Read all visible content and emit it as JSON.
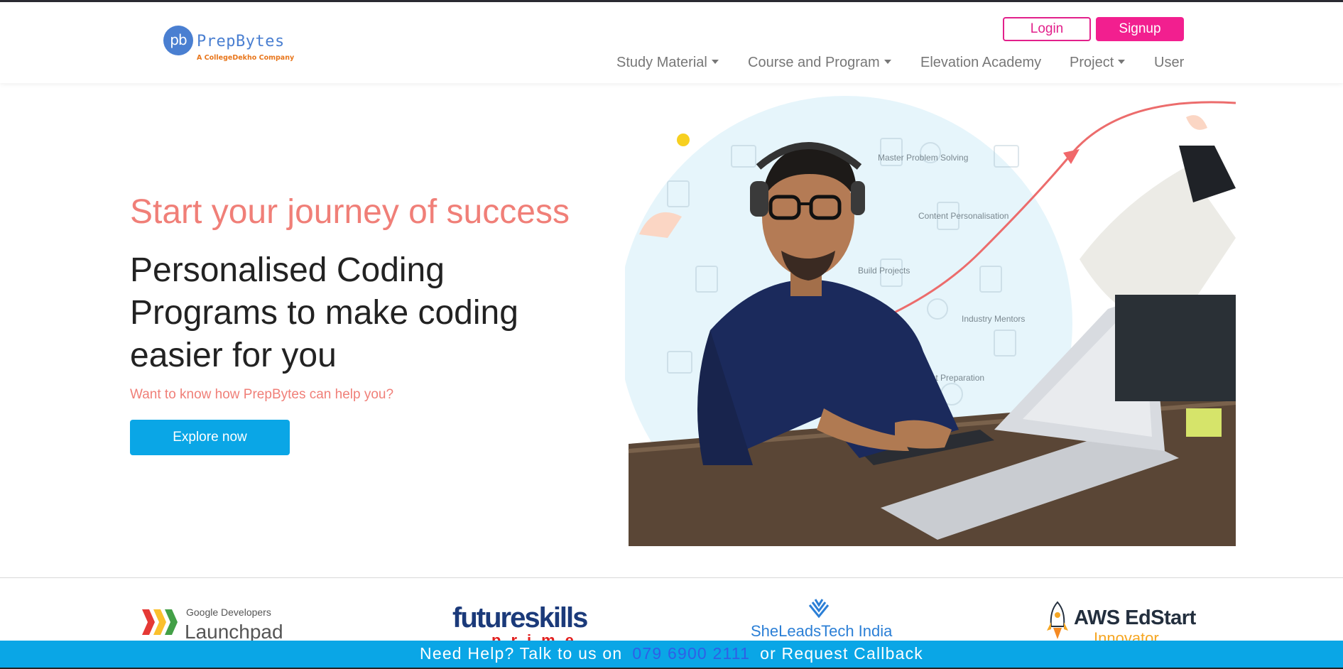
{
  "header": {
    "logo_initials": "pb",
    "logo_name": "PrepBytes",
    "logo_tagline": "A CollegeDekho Company",
    "login_label": "Login",
    "signup_label": "Signup",
    "nav": [
      {
        "label": "Study Material",
        "dropdown": true
      },
      {
        "label": "Course and Program",
        "dropdown": true
      },
      {
        "label": "Elevation Academy",
        "dropdown": false
      },
      {
        "label": "Project",
        "dropdown": true
      },
      {
        "label": "User",
        "dropdown": false
      }
    ]
  },
  "hero": {
    "subtitle": "Start your journey of success",
    "title": "Personalised Coding Programs to make coding easier for you",
    "question": "Want to know how PrepBytes can help you?",
    "cta_label": "Explore now",
    "image_labels": [
      "Master Problem Solving",
      "Content Personalisation",
      "Build Projects",
      "Industry Mentors",
      "Placement Preparation"
    ]
  },
  "partners": {
    "google_small": "Google Developers",
    "google_big": "Launchpad",
    "futureskills": "futureskills",
    "futureskills_sub": "prime",
    "sheleads": "SheLeadsTech India",
    "aws_big": "AWS EdStart",
    "aws_small": "Innovator"
  },
  "help_bar": {
    "prefix": "Need Help? Talk to us on",
    "phone": "079 6900 2111",
    "suffix": "or Request Callback"
  },
  "colors": {
    "brand_blue": "#4a7fd1",
    "pink": "#f21f8f",
    "coral": "#f07f78",
    "cta_blue": "#0aa6e6"
  }
}
